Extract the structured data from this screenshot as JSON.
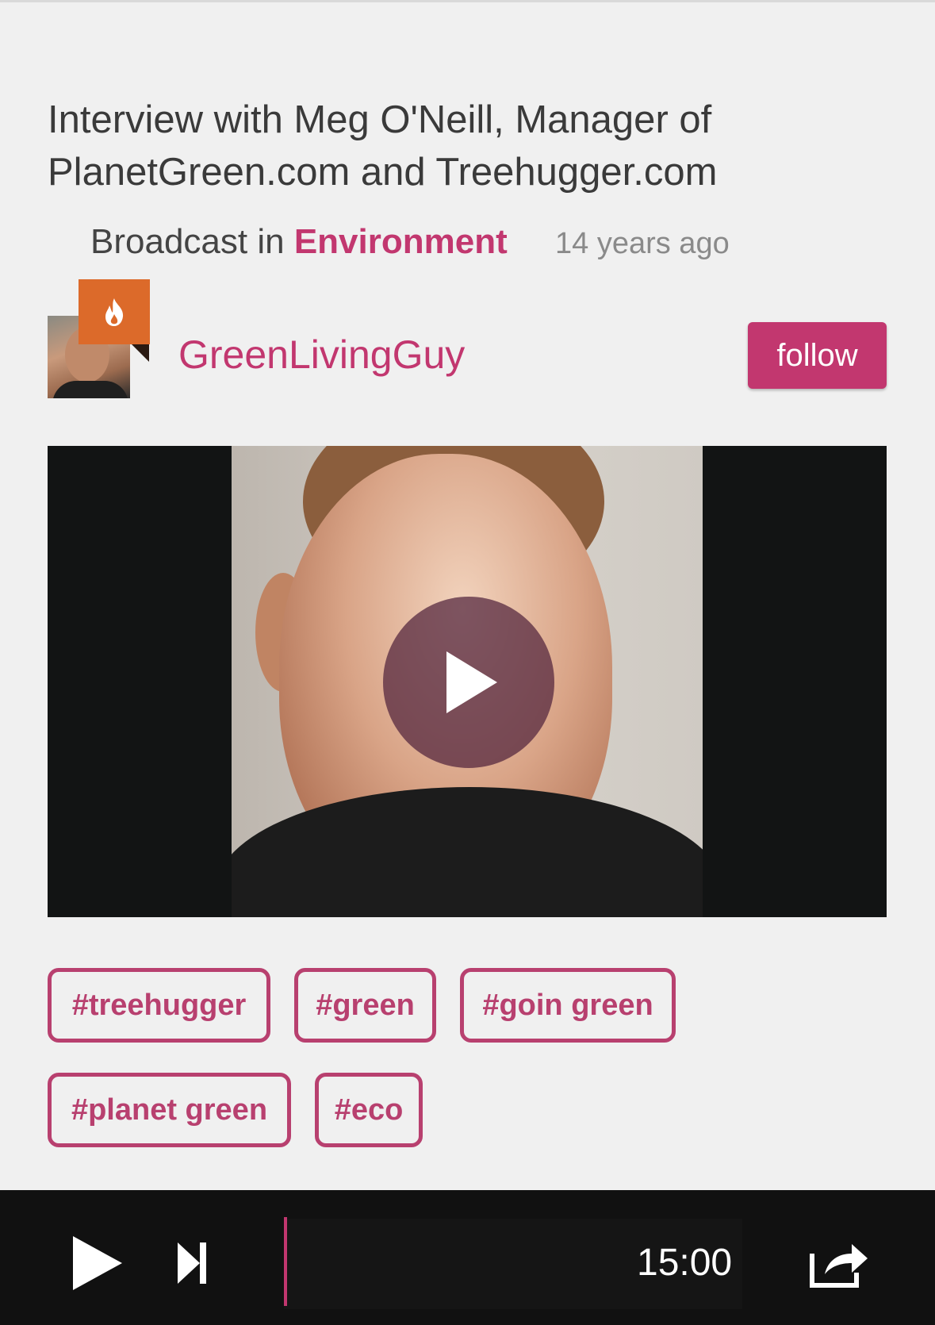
{
  "episode": {
    "title": "Interview with Meg O'Neill, Manager of PlanetGreen.com and Treehugger.com",
    "broadcast_prefix": "Broadcast in ",
    "category": "Environment",
    "age": "14 years ago"
  },
  "host": {
    "username": "GreenLivingGuy",
    "follow_label": "follow",
    "badge_icon": "flame-icon",
    "badge_color": "#dc6a2a"
  },
  "tags": [
    "#treehugger",
    "#green",
    "#goin green",
    "#planet green",
    "#eco"
  ],
  "player": {
    "duration": "15:00",
    "progress": 0
  },
  "colors": {
    "accent": "#c2376f",
    "background": "#f0f0f0",
    "player_bg": "#111111"
  }
}
